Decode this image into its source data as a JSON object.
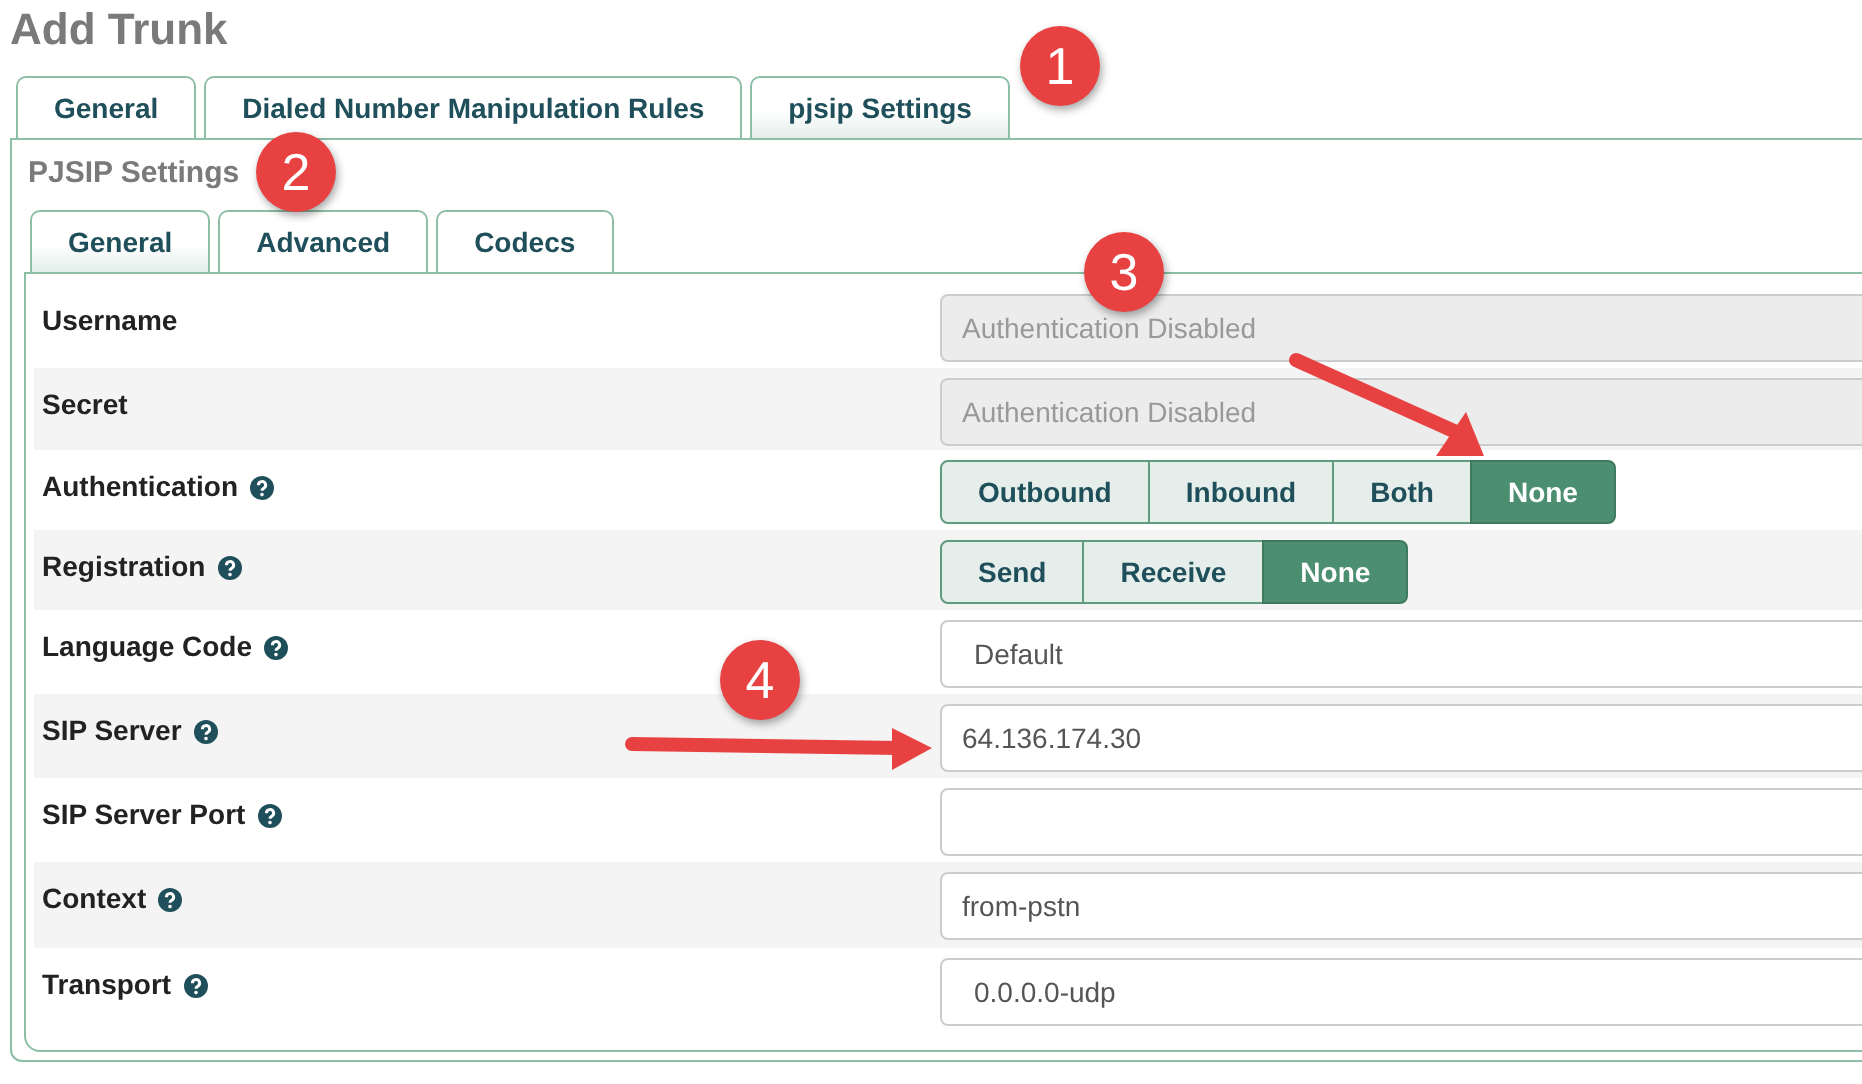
{
  "title": "Add Trunk",
  "tabs": [
    {
      "label": "General",
      "selected": false
    },
    {
      "label": "Dialed Number Manipulation Rules",
      "selected": false
    },
    {
      "label": "pjsip Settings",
      "selected": true
    }
  ],
  "section": {
    "title": "PJSIP Settings",
    "tabs": [
      {
        "label": "General",
        "selected": true
      },
      {
        "label": "Advanced",
        "selected": false
      },
      {
        "label": "Codecs",
        "selected": false
      }
    ],
    "rows": [
      {
        "label": "Username",
        "help": false,
        "kind": "input",
        "disabled": true,
        "placeholder": "Authentication Disabled"
      },
      {
        "label": "Secret",
        "help": false,
        "kind": "input",
        "disabled": true,
        "placeholder": "Authentication Disabled"
      },
      {
        "label": "Authentication",
        "help": true,
        "kind": "buttons",
        "options": [
          {
            "label": "Outbound",
            "selected": false
          },
          {
            "label": "Inbound",
            "selected": false
          },
          {
            "label": "Both",
            "selected": false
          },
          {
            "label": "None",
            "selected": true
          }
        ]
      },
      {
        "label": "Registration",
        "help": true,
        "kind": "buttons",
        "options": [
          {
            "label": "Send",
            "selected": false
          },
          {
            "label": "Receive",
            "selected": false
          },
          {
            "label": "None",
            "selected": true
          }
        ]
      },
      {
        "label": "Language Code",
        "help": true,
        "kind": "select",
        "value": "Default"
      },
      {
        "label": "SIP Server",
        "help": true,
        "kind": "input",
        "disabled": false,
        "value": "64.136.174.30"
      },
      {
        "label": "SIP Server Port",
        "help": true,
        "kind": "input",
        "disabled": false,
        "value": ""
      },
      {
        "label": "Context",
        "help": true,
        "kind": "input",
        "disabled": false,
        "value": "from-pstn"
      },
      {
        "label": "Transport",
        "help": true,
        "kind": "select",
        "value": "0.0.0.0-udp"
      }
    ]
  },
  "annotations": [
    {
      "number": "1",
      "arrow": false
    },
    {
      "number": "2",
      "arrow": false
    },
    {
      "number": "3",
      "arrow": true
    },
    {
      "number": "4",
      "arrow": true
    }
  ]
}
